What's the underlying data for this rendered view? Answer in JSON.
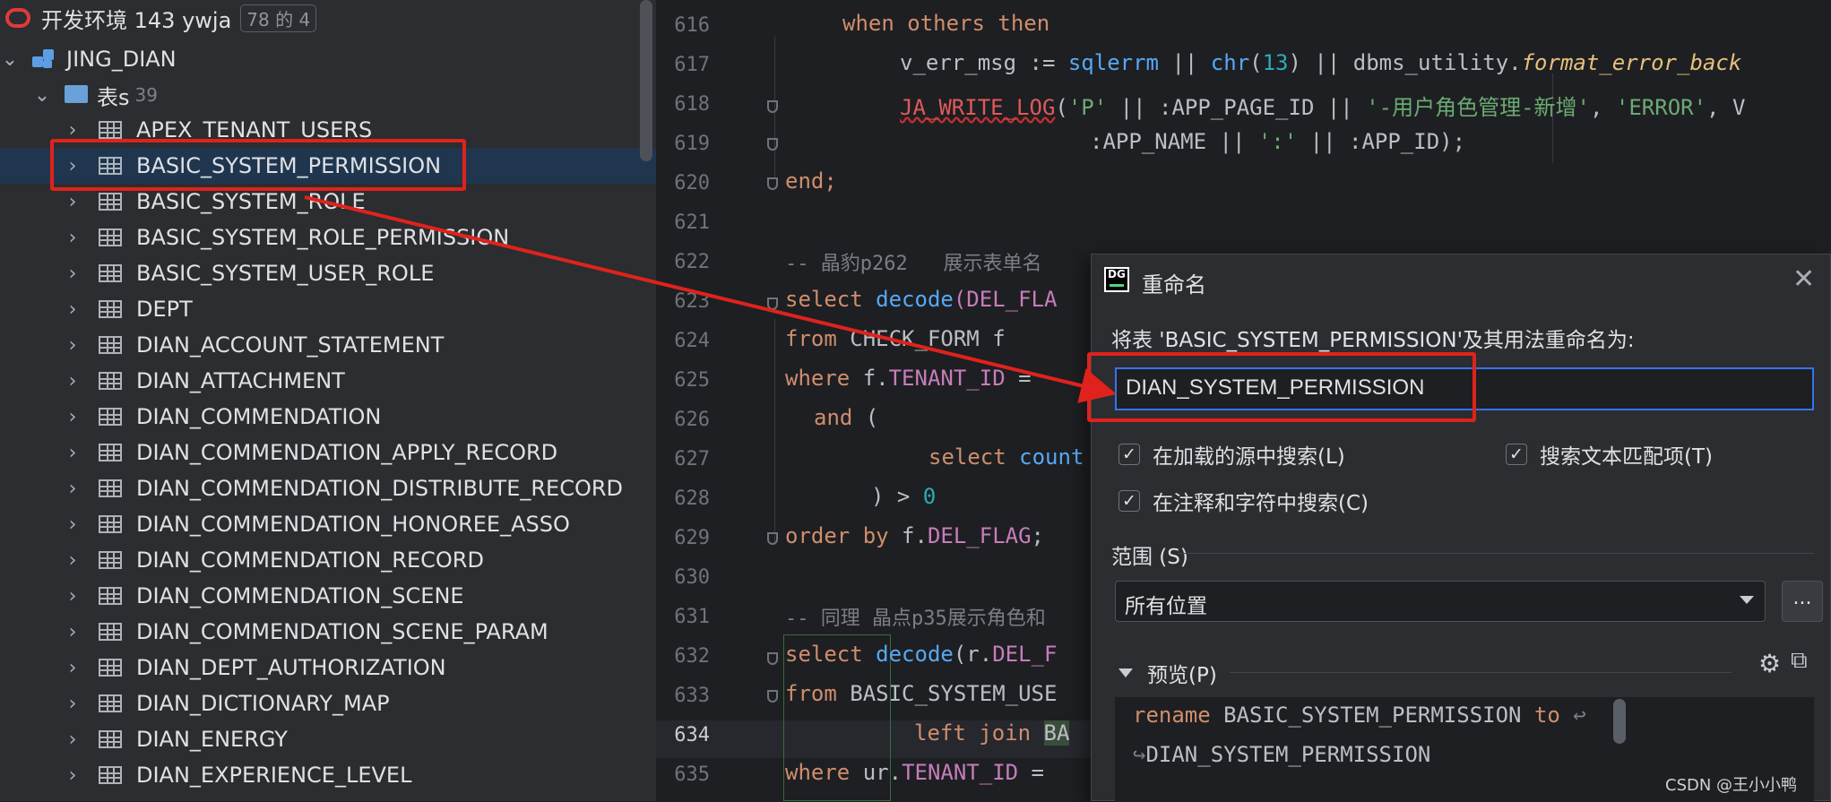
{
  "tree": {
    "connection": {
      "label": "开发环境 143 ywja",
      "badge": "78 的 4"
    },
    "schema": {
      "label": "JING_DIAN"
    },
    "folder": {
      "label": "表s",
      "count": "39"
    },
    "tables": [
      "APEX_TENANT_USERS",
      "BASIC_SYSTEM_PERMISSION",
      "BASIC_SYSTEM_ROLE",
      "BASIC_SYSTEM_ROLE_PERMISSION",
      "BASIC_SYSTEM_USER_ROLE",
      "DEPT",
      "DIAN_ACCOUNT_STATEMENT",
      "DIAN_ATTACHMENT",
      "DIAN_COMMENDATION",
      "DIAN_COMMENDATION_APPLY_RECORD",
      "DIAN_COMMENDATION_DISTRIBUTE_RECORD",
      "DIAN_COMMENDATION_HONOREE_ASSO",
      "DIAN_COMMENDATION_RECORD",
      "DIAN_COMMENDATION_SCENE",
      "DIAN_COMMENDATION_SCENE_PARAM",
      "DIAN_DEPT_AUTHORIZATION",
      "DIAN_DICTIONARY_MAP",
      "DIAN_ENERGY",
      "DIAN_EXPERIENCE_LEVEL"
    ],
    "selected_table": "BASIC_SYSTEM_PERMISSION"
  },
  "editor": {
    "line_numbers": [
      "616",
      "617",
      "618",
      "619",
      "620",
      "621",
      "622",
      "623",
      "624",
      "625",
      "626",
      "627",
      "628",
      "629",
      "630",
      "631",
      "632",
      "633",
      "634",
      "635"
    ],
    "current_line": "634",
    "code": {
      "l616_a": "when others then",
      "l617_a": "v_err_msg := ",
      "l617_b": "sqlerrm",
      "l617_c": " || ",
      "l617_d": "chr",
      "l617_e": "(",
      "l617_f": "13",
      "l617_g": ") || dbms_utility.",
      "l617_h": "format_error_back",
      "l618_a": "JA_WRITE_LOG",
      "l618_b": "(",
      "l618_c": "'P'",
      "l618_d": " || :APP_PAGE_ID || ",
      "l618_e": "'-用户角色管理-新增'",
      "l618_f": ", ",
      "l618_g": "'ERROR'",
      "l618_h": ", V",
      "l619_a": ":APP_NAME || ",
      "l619_b": "':'",
      "l619_c": " || :APP_ID);",
      "l620": "end;",
      "l622": "-- 晶豹p262   展示表单名",
      "l623_a": "select ",
      "l623_b": "decode",
      "l623_c": "(DEL_FLA",
      "l624_a": "from ",
      "l624_b": "CHECK_FORM f",
      "l625_a": "where ",
      "l625_b": "f.",
      "l625_c": "TENANT_ID",
      "l625_d": " = ",
      "l626_a": "and",
      "l626_b": " (",
      "l627_a": "select ",
      "l627_b": "count",
      "l628_a": ") > ",
      "l628_b": "0",
      "l629_a": "order by ",
      "l629_b": "f.",
      "l629_c": "DEL_FLAG",
      "l629_d": ";",
      "l631": "-- 同理 晶点p35展示角色和",
      "l632_a": "select ",
      "l632_b": "decode",
      "l632_c": "(r.",
      "l632_d": "DEL_F",
      "l633_a": "from ",
      "l633_b": "BASIC_SYSTEM_USE",
      "l634_a": "left join ",
      "l634_b": "BA",
      "l635_a": "where ",
      "l635_b": "ur.",
      "l635_c": "TENANT_ID",
      "l635_d": " ="
    }
  },
  "dialog": {
    "logo": "DG",
    "title": "重命名",
    "prompt": "将表 'BASIC_SYSTEM_PERMISSION'及其用法重命名为:",
    "new_name": "DIAN_SYSTEM_PERMISSION",
    "options": [
      {
        "label": "在加载的源中搜索(L)",
        "checked": true
      },
      {
        "label": "搜索文本匹配项(T)",
        "checked": true
      },
      {
        "label": "在注释和字符中搜索(C)",
        "checked": true
      }
    ],
    "scope_label": "范围 (S)",
    "scope_value": "所有位置",
    "scope_more": "...",
    "preview_label": "预览(P)",
    "preview": {
      "kw": "rename",
      "old": " BASIC_SYSTEM_PERMISSION ",
      "to": "to",
      "new": "DIAN_SYSTEM_PERMISSION",
      "wrap_end": "↩",
      "wrap_start": "↪"
    }
  },
  "watermark": "CSDN @王小小鸭",
  "colors": {
    "annotation": "#e0221c",
    "selection": "#20364f",
    "accent": "#3574f0"
  }
}
